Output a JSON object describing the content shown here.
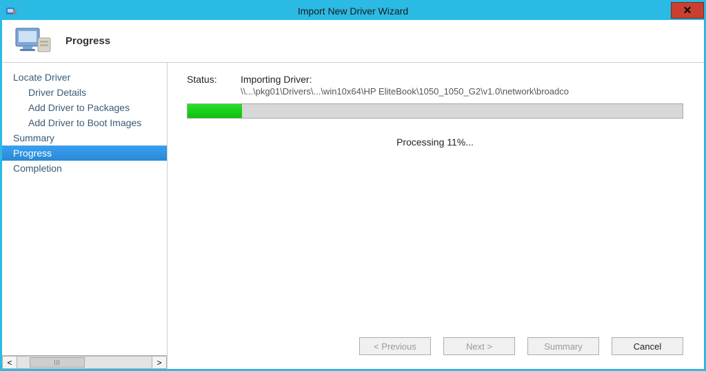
{
  "window": {
    "title": "Import New Driver Wizard"
  },
  "header": {
    "page_title": "Progress"
  },
  "sidebar": {
    "items": [
      {
        "label": "Locate Driver",
        "sub": false,
        "selected": false
      },
      {
        "label": "Driver Details",
        "sub": true,
        "selected": false
      },
      {
        "label": "Add Driver to Packages",
        "sub": true,
        "selected": false
      },
      {
        "label": "Add Driver to Boot Images",
        "sub": true,
        "selected": false
      },
      {
        "label": "Summary",
        "sub": false,
        "selected": false
      },
      {
        "label": "Progress",
        "sub": false,
        "selected": true
      },
      {
        "label": "Completion",
        "sub": false,
        "selected": false
      }
    ]
  },
  "content": {
    "status_label": "Status:",
    "status_line1": "Importing Driver:",
    "status_line2": "\\\\...\\pkg01\\Drivers\\...\\win10x64\\HP EliteBook\\1050_1050_G2\\v1.0\\network\\broadco",
    "progress_percent": 11,
    "processing_text": "Processing 11%..."
  },
  "footer": {
    "previous": "< Previous",
    "next": "Next >",
    "summary": "Summary",
    "cancel": "Cancel"
  }
}
